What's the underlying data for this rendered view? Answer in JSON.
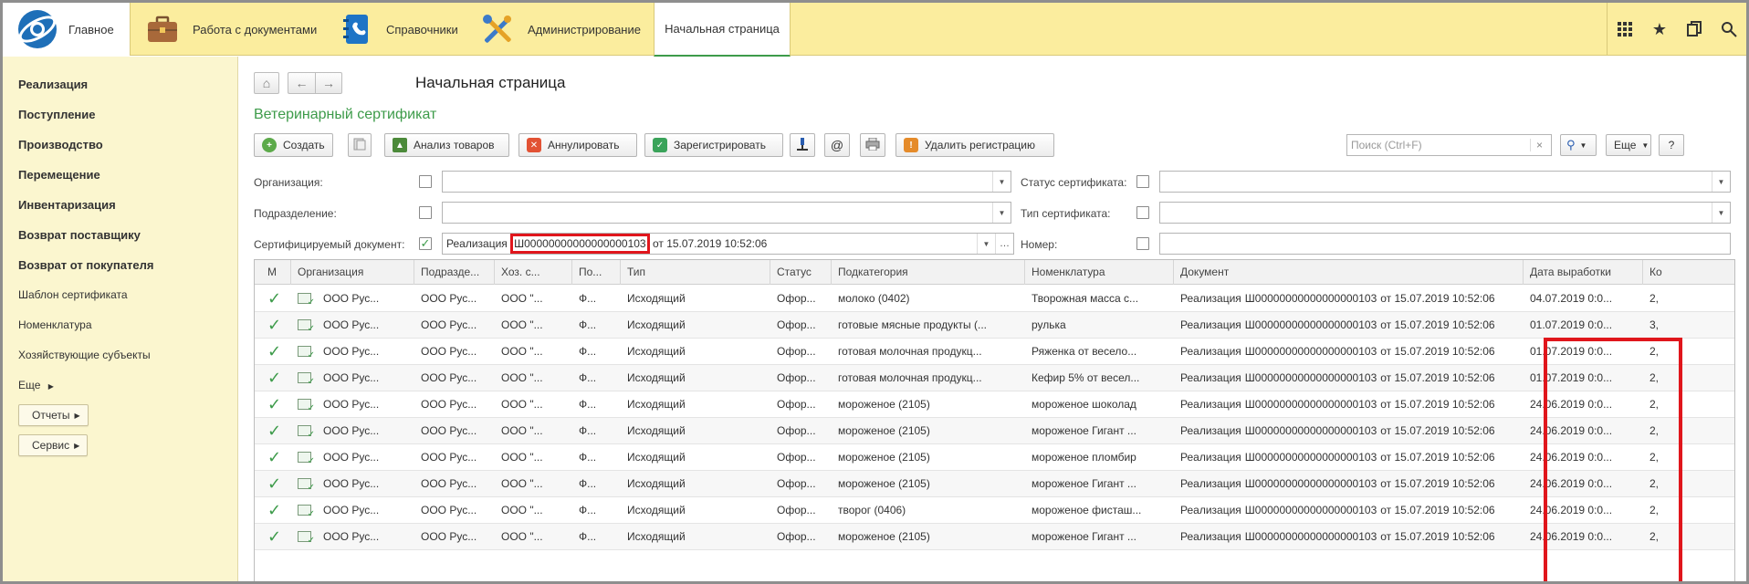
{
  "topbar": {
    "sections": [
      {
        "label": "Главное",
        "icon": "logo-icon"
      },
      {
        "label": "Работа с документами",
        "icon": "briefcase-icon"
      },
      {
        "label": "Справочники",
        "icon": "address-book-icon"
      },
      {
        "label": "Администрирование",
        "icon": "tools-icon"
      }
    ],
    "start_tab": "Начальная страница",
    "right_icons": [
      "apps-grid-icon",
      "star-icon",
      "history-icon",
      "search-icon"
    ]
  },
  "sidebar": {
    "items": [
      {
        "label": "Реализация",
        "bold": true
      },
      {
        "label": "Поступление",
        "bold": true
      },
      {
        "label": "Производство",
        "bold": true
      },
      {
        "label": "Перемещение",
        "bold": true
      },
      {
        "label": "Инвентаризация",
        "bold": true
      },
      {
        "label": "Возврат поставщику",
        "bold": true
      },
      {
        "label": "Возврат от покупателя",
        "bold": true
      },
      {
        "label": "Шаблон сертификата",
        "bold": false
      },
      {
        "label": "Номенклатура",
        "bold": false
      },
      {
        "label": "Хозяйствующие субъекты",
        "bold": false
      },
      {
        "label": "Еще",
        "bold": false
      }
    ],
    "buttons": [
      "Отчеты",
      "Сервис"
    ]
  },
  "main": {
    "page_title": "Начальная страница",
    "form_title": "Ветеринарный сертификат",
    "toolbar": {
      "create": "Создать",
      "analyze": "Анализ товаров",
      "cancel": "Аннулировать",
      "register": "Зарегистрировать",
      "delete_reg": "Удалить регистрацию",
      "search_placeholder": "Поиск (Ctrl+F)",
      "more": "Еще",
      "help": "?"
    },
    "filters": {
      "org_label": "Организация:",
      "dept_label": "Подразделение:",
      "doc_label": "Сертифицируемый документ:",
      "doc_prefix": "Реализация",
      "doc_number": "Ш00000000000000000103",
      "doc_suffix": " от 15.07.2019 10:52:06",
      "status_label": "Статус сертификата:",
      "type_label": "Тип сертификата:",
      "number_label": "Номер:"
    },
    "columns": [
      "М",
      "Организация",
      "Подразде...",
      "Хоз. с...",
      "По...",
      "Тип",
      "Статус",
      "Подкатегория",
      "Номенклатура",
      "Документ",
      "Дата выработки",
      "Ко"
    ],
    "rows": [
      {
        "org": "ООО Рус...",
        "dept": "ООО Рус...",
        "hoz": "ООО \"...",
        "po": "Ф...",
        "type": "Исходящий",
        "status": "Офор...",
        "subcat": "молоко (0402)",
        "nom": "Творожная масса с...",
        "doc_prefix": "Реализация",
        "doc_num": "Ш00000000000000000103",
        "doc_suffix": "от 15.07.2019 10:52:06",
        "date": "04.07.2019 0:0...",
        "qty": "2,"
      },
      {
        "org": "ООО Рус...",
        "dept": "ООО Рус...",
        "hoz": "ООО \"...",
        "po": "Ф...",
        "type": "Исходящий",
        "status": "Офор...",
        "subcat": "готовые мясные продукты (...",
        "nom": "рулька",
        "doc_prefix": "Реализация",
        "doc_num": "Ш00000000000000000103",
        "doc_suffix": "от 15.07.2019 10:52:06",
        "date": "01.07.2019 0:0...",
        "qty": "3,"
      },
      {
        "org": "ООО Рус...",
        "dept": "ООО Рус...",
        "hoz": "ООО \"...",
        "po": "Ф...",
        "type": "Исходящий",
        "status": "Офор...",
        "subcat": "готовая молочная продукц...",
        "nom": "Ряженка от весело...",
        "doc_prefix": "Реализация",
        "doc_num": "Ш00000000000000000103",
        "doc_suffix": "от 15.07.2019 10:52:06",
        "date": "01.07.2019 0:0...",
        "qty": "2,"
      },
      {
        "org": "ООО Рус...",
        "dept": "ООО Рус...",
        "hoz": "ООО \"...",
        "po": "Ф...",
        "type": "Исходящий",
        "status": "Офор...",
        "subcat": "готовая молочная продукц...",
        "nom": "Кефир 5% от весел...",
        "doc_prefix": "Реализация",
        "doc_num": "Ш00000000000000000103",
        "doc_suffix": "от 15.07.2019 10:52:06",
        "date": "01.07.2019 0:0...",
        "qty": "2,"
      },
      {
        "org": "ООО Рус...",
        "dept": "ООО Рус...",
        "hoz": "ООО \"...",
        "po": "Ф...",
        "type": "Исходящий",
        "status": "Офор...",
        "subcat": "мороженое (2105)",
        "nom": "мороженое шоколад",
        "doc_prefix": "Реализация",
        "doc_num": "Ш00000000000000000103",
        "doc_suffix": "от 15.07.2019 10:52:06",
        "date": "24.06.2019 0:0...",
        "qty": "2,"
      },
      {
        "org": "ООО Рус...",
        "dept": "ООО Рус...",
        "hoz": "ООО \"...",
        "po": "Ф...",
        "type": "Исходящий",
        "status": "Офор...",
        "subcat": "мороженое (2105)",
        "nom": "мороженое Гигант ...",
        "doc_prefix": "Реализация",
        "doc_num": "Ш00000000000000000103",
        "doc_suffix": "от 15.07.2019 10:52:06",
        "date": "24.06.2019 0:0...",
        "qty": "2,"
      },
      {
        "org": "ООО Рус...",
        "dept": "ООО Рус...",
        "hoz": "ООО \"...",
        "po": "Ф...",
        "type": "Исходящий",
        "status": "Офор...",
        "subcat": "мороженое (2105)",
        "nom": "мороженое пломбир",
        "doc_prefix": "Реализация",
        "doc_num": "Ш00000000000000000103",
        "doc_suffix": "от 15.07.2019 10:52:06",
        "date": "24.06.2019 0:0...",
        "qty": "2,"
      },
      {
        "org": "ООО Рус...",
        "dept": "ООО Рус...",
        "hoz": "ООО \"...",
        "po": "Ф...",
        "type": "Исходящий",
        "status": "Офор...",
        "subcat": "мороженое (2105)",
        "nom": "мороженое Гигант ...",
        "doc_prefix": "Реализация",
        "doc_num": "Ш00000000000000000103",
        "doc_suffix": "от 15.07.2019 10:52:06",
        "date": "24.06.2019 0:0...",
        "qty": "2,"
      },
      {
        "org": "ООО Рус...",
        "dept": "ООО Рус...",
        "hoz": "ООО \"...",
        "po": "Ф...",
        "type": "Исходящий",
        "status": "Офор...",
        "subcat": "творог (0406)",
        "nom": "мороженое фисташ...",
        "doc_prefix": "Реализация",
        "doc_num": "Ш00000000000000000103",
        "doc_suffix": "от 15.07.2019 10:52:06",
        "date": "24.06.2019 0:0...",
        "qty": "2,"
      },
      {
        "org": "ООО Рус...",
        "dept": "ООО Рус...",
        "hoz": "ООО \"...",
        "po": "Ф...",
        "type": "Исходящий",
        "status": "Офор...",
        "subcat": "мороженое (2105)",
        "nom": "мороженое Гигант ...",
        "doc_prefix": "Реализация",
        "doc_num": "Ш00000000000000000103",
        "doc_suffix": "от 15.07.2019 10:52:06",
        "date": "24.06.2019 0:0...",
        "qty": "2,"
      }
    ]
  },
  "colors": {
    "accent_green": "#3d9b4a",
    "topbar_yellow": "#fbed9e",
    "sidebar_yellow": "#fbf6cf",
    "highlight_red": "#e0161c"
  }
}
